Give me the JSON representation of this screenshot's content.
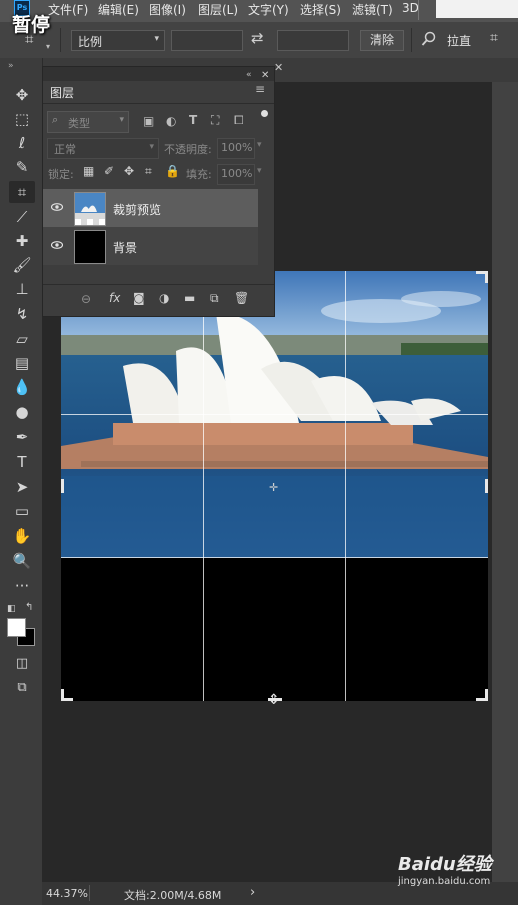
{
  "overlay": {
    "pause_label": "暂停"
  },
  "app": {
    "logo": "Ps"
  },
  "menu": [
    "文件(F)",
    "编辑(E)",
    "图像(I)",
    "图层(L)",
    "文字(Y)",
    "选择(S)",
    "滤镜(T)",
    "3D"
  ],
  "options_bar": {
    "ratio_select": "比例",
    "clear_button": "清除",
    "straighten_label": "拉直"
  },
  "layers_panel": {
    "title": "图层",
    "filter_kind": "类型",
    "blend_mode": "正常",
    "opacity_label": "不透明度:",
    "opacity_value": "100%",
    "lock_label": "锁定:",
    "fill_label": "填充:",
    "fill_value": "100%",
    "layers": [
      {
        "name": "裁剪预览",
        "selected": true
      },
      {
        "name": "背景",
        "selected": false
      }
    ]
  },
  "status": {
    "zoom": "44.37%",
    "doc_info": "文档:2.00M/4.68M",
    "arrow": "›"
  },
  "watermark": {
    "brand": "Baidu经验",
    "url": "jingyan.baidu.com"
  },
  "colors": {
    "ui_dark": "#2b2b2b",
    "panel": "#3d3d3d",
    "accent": "#31a8ff",
    "sky": "#6f9fd0",
    "water": "#1e4f86"
  }
}
